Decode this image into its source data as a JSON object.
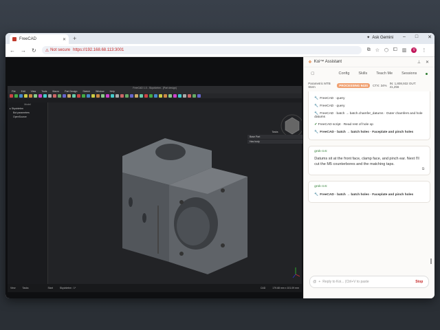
{
  "browser": {
    "tab_title": "FreeCAD",
    "new_tab": "+",
    "gemini_label": "Ask Gemini",
    "not_secure": "Not secure",
    "url": "https://192.168.68.113:3001",
    "avatar_letter": "V"
  },
  "freecad": {
    "window_title": "FreeCAD 1.0 - Skyvidebm - [Part design]",
    "menu": [
      "File",
      "Edit",
      "View",
      "Tools",
      "Macro",
      "Part Design",
      "Sketch",
      "Window",
      "Help"
    ],
    "workbench": "Part Design",
    "tree": {
      "tab_label": "Model",
      "document": "Skyvidebm",
      "items": [
        "Bot parameters",
        "OpenSource"
      ]
    },
    "tasks": {
      "header": "Tasks",
      "rows": [
        "Base Part",
        "Has body"
      ]
    },
    "bottom_tabs": [
      "View",
      "Tasks"
    ],
    "status_tabs": [
      "Start",
      "Skyvidebm : 1*"
    ],
    "status_right": [
      "CAD",
      "179.68 mm x 101.09 mm"
    ]
  },
  "koi": {
    "title": "Koi™ Assistant",
    "nav": [
      "Config",
      "Skills",
      "Teach Me",
      "Sessions"
    ],
    "status": {
      "project": "Parametric MTB Stem",
      "processing": "PROCESSING",
      "processing_time": "943S",
      "ctx": "CTX: 34%",
      "in_out": "IN: 1,808,932 OUT: 41,256"
    },
    "tool_calls_1": [
      {
        "icon": "wrench",
        "text": "FreeCAD · query"
      },
      {
        "icon": "wrench",
        "text": "FreeCAD · query"
      },
      {
        "icon": "wrench",
        "text": "FreeCAD · batch → batch.chamfer_datums · Outer chamfers and hole datums"
      },
      {
        "icon": "check",
        "text": "FreeCAD script · Read rest of hole op"
      },
      {
        "icon": "wrench",
        "text": "FreeCAD · batch → batch holes · Faceplate and pinch holes"
      }
    ],
    "message": {
      "sender": "grok-4.6:",
      "text": "Datums sit at the front face, clamp face, and pinch ear. Next I'll cut the M5 counterbores and the matching taps."
    },
    "message2": {
      "sender": "grok-4.6:",
      "tool": "FreeCAD · batch → batch holes · Faceplate and pinch holes"
    },
    "composer": {
      "placeholder": "Reply to Koi... (Ctrl+V to paste",
      "stop": "Stop"
    }
  }
}
